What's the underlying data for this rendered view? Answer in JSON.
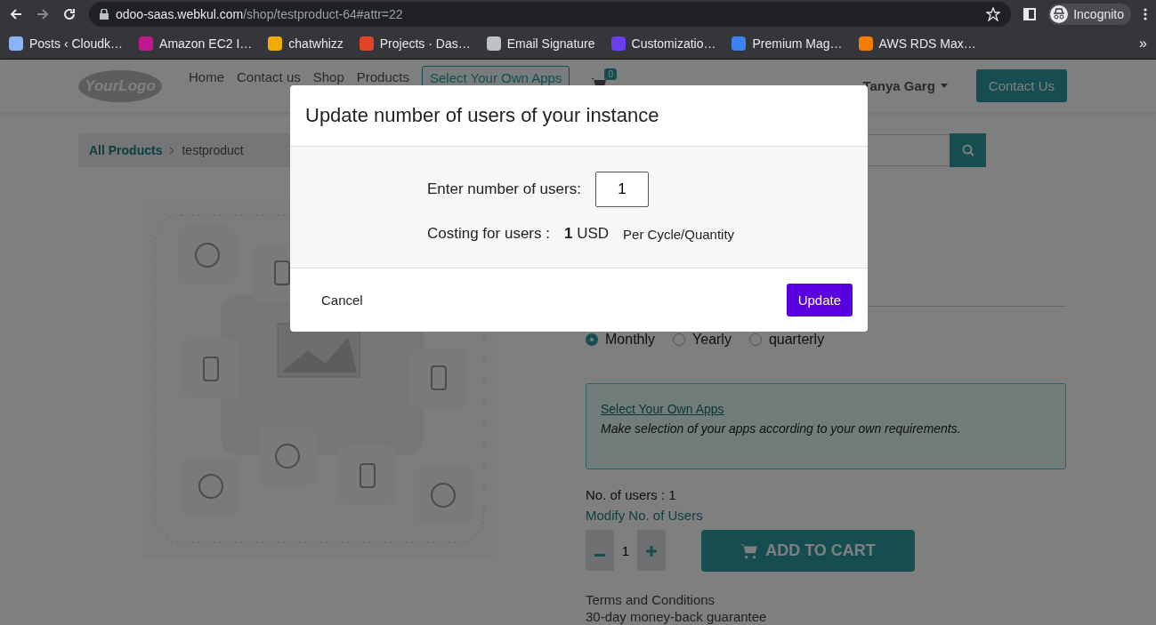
{
  "browser": {
    "url_host": "odoo-saas.webkul.com",
    "url_path": "/shop/testproduct-64#attr=22",
    "profile": "Incognito",
    "bookmarks": [
      {
        "label": "Posts ‹ Cloudk…",
        "color": "#8ab4f8"
      },
      {
        "label": "Amazon EC2 I…",
        "color": "#c2188f"
      },
      {
        "label": "chatwhizz",
        "color": "#f2a900"
      },
      {
        "label": "Projects · Das…",
        "color": "#e24329"
      },
      {
        "label": "Email Signature",
        "color": "#bdc1c6"
      },
      {
        "label": "Customizatio…",
        "color": "#6a3df0"
      },
      {
        "label": "Premium Mag…",
        "color": "#3b82f6"
      },
      {
        "label": "AWS RDS Max…",
        "color": "#f57c00"
      }
    ],
    "more": "»"
  },
  "navbar": {
    "logo": "YourLogo",
    "links": [
      {
        "label": "Home",
        "kind": "link"
      },
      {
        "label": "Contact us",
        "kind": "link"
      },
      {
        "label": "Shop",
        "kind": "link"
      },
      {
        "label": "Products",
        "kind": "link"
      },
      {
        "label": "Select Your Own Apps",
        "kind": "outlined"
      }
    ],
    "cart_count": "0",
    "user": "Tanya Garg",
    "contact_button": "Contact Us"
  },
  "breadcrumb": [
    {
      "label": "All Products",
      "kind": "link"
    },
    {
      "label": "testproduct",
      "kind": "current"
    }
  ],
  "billing_cycles": [
    {
      "label": "Monthly",
      "selected": true
    },
    {
      "label": "Yearly",
      "selected": false
    },
    {
      "label": "quarterly",
      "selected": false
    }
  ],
  "apps_info": {
    "link": "Select Your Own Apps",
    "description": "Make selection of your apps according to your own requirements."
  },
  "users_text": "No. of users : 1",
  "modify_link": "Modify No. of Users",
  "quantity": "1",
  "add_to_cart": "ADD TO CART",
  "terms": [
    "Terms and Conditions",
    "30-day money-back guarantee"
  ],
  "modal": {
    "title": "Update number of users of your instance",
    "users_label": "Enter number of users:",
    "users_value": "1",
    "cost_label": "Costing for users :",
    "cost_amount": "**1** USD",
    "cost_note": "Per Cycle/Quantity",
    "cancel": "Cancel",
    "update": "Update"
  }
}
